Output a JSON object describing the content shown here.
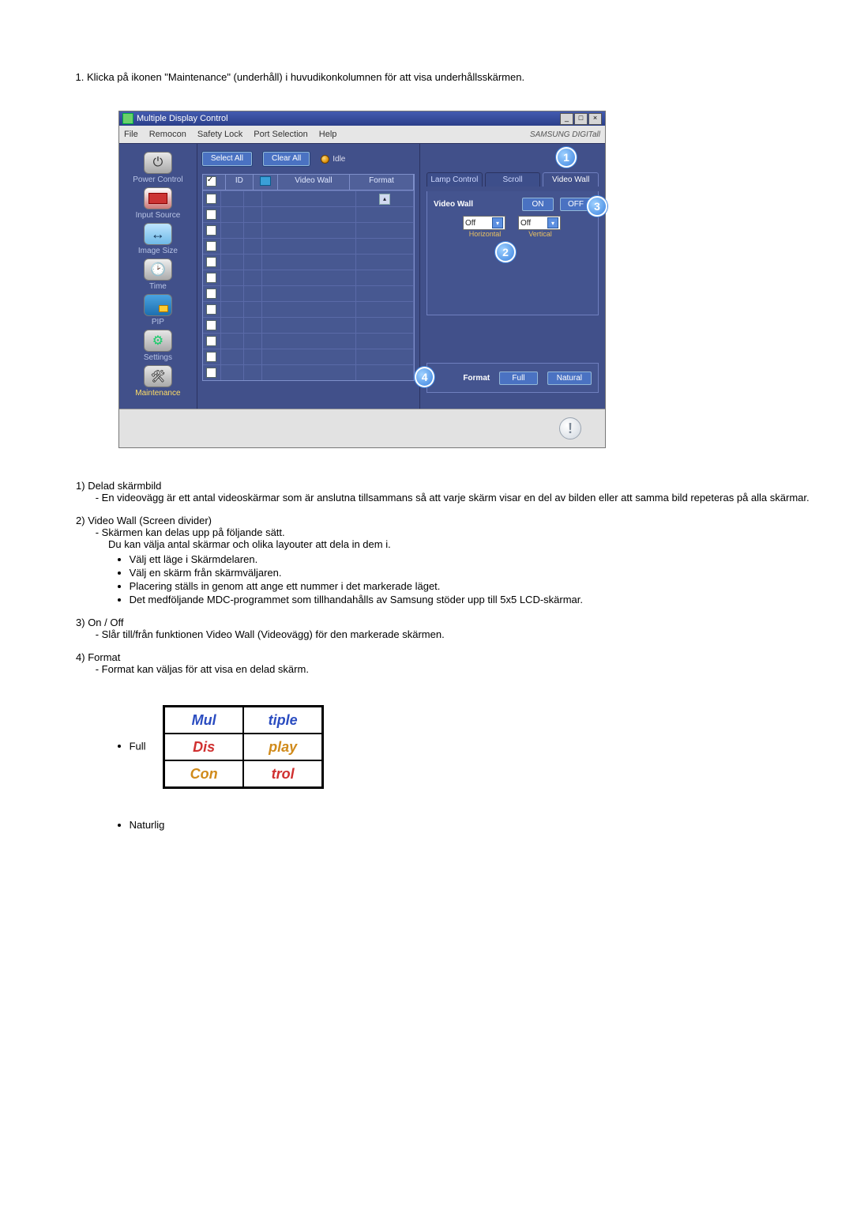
{
  "intro_item": "Klicka på ikonen \"Maintenance\" (underhåll) i huvudikonkolumnen för att visa underhållsskärmen.",
  "app": {
    "title": "Multiple Display Control",
    "menu": [
      "File",
      "Remocon",
      "Safety Lock",
      "Port Selection",
      "Help"
    ],
    "brand": "SAMSUNG DIGITall",
    "win_btns": {
      "min": "_",
      "max": "□",
      "close": "×"
    },
    "sidebar": [
      {
        "label": "Power Control",
        "icon": "power"
      },
      {
        "label": "Input Source",
        "icon": "input"
      },
      {
        "label": "Image Size",
        "icon": "size"
      },
      {
        "label": "Time",
        "icon": "time"
      },
      {
        "label": "PIP",
        "icon": "pip"
      },
      {
        "label": "Settings",
        "icon": "settings"
      },
      {
        "label": "Maintenance",
        "icon": "maint",
        "active": true
      }
    ],
    "buttons": {
      "select_all": "Select All",
      "clear_all": "Clear All",
      "idle": "Idle"
    },
    "grid": {
      "headers": {
        "id": "ID",
        "video_wall": "Video Wall",
        "format": "Format"
      },
      "row_count": 12,
      "checked_row_ids": [
        "ID"
      ]
    },
    "tabs": [
      "Lamp Control",
      "Scroll",
      "Video Wall"
    ],
    "active_tab": 2,
    "video_wall": {
      "label": "Video Wall",
      "on": "ON",
      "off": "OFF",
      "horizontal_label": "Horizontal",
      "vertical_label": "Vertical",
      "horizontal_value": "Off",
      "vertical_value": "Off"
    },
    "format_panel": {
      "label": "Format",
      "full": "Full",
      "natural": "Natural"
    },
    "callouts": {
      "c1": "1",
      "c2": "2",
      "c3": "3",
      "c4": "4"
    }
  },
  "desc": {
    "s1": {
      "num": "1)",
      "title": "Delad skärmbild",
      "d1": "En videovägg är ett antal videoskärmar som är anslutna tillsammans så att varje skärm visar en del av bilden eller att samma bild repeteras på alla skärmar."
    },
    "s2": {
      "num": "2)",
      "title": "Video Wall (Screen divider)",
      "d1": "Skärmen kan delas upp på följande sätt.",
      "d2": "Du kan välja antal skärmar och olika layouter att dela in dem i.",
      "b": [
        "Välj ett läge i Skärmdelaren.",
        "Välj en skärm från skärmväljaren.",
        "Placering ställs in genom att ange ett nummer i det markerade läget.",
        "Det medföljande MDC-programmet som tillhandahålls av Samsung stöder upp till 5x5 LCD-skärmar."
      ]
    },
    "s3": {
      "num": "3)",
      "title": "On / Off",
      "d1": "Slår till/från funktionen Video Wall (Videovägg) för den markerade skärmen."
    },
    "s4": {
      "num": "4)",
      "title": "Format",
      "d1": "Format kan väljas för att visa en delad skärm.",
      "full": "Full",
      "natural": "Naturlig"
    }
  },
  "diagram": {
    "w1": "Mul",
    "w2": "tiple",
    "w3": "Dis",
    "w4": "play",
    "w5": "Con",
    "w6": "trol"
  }
}
